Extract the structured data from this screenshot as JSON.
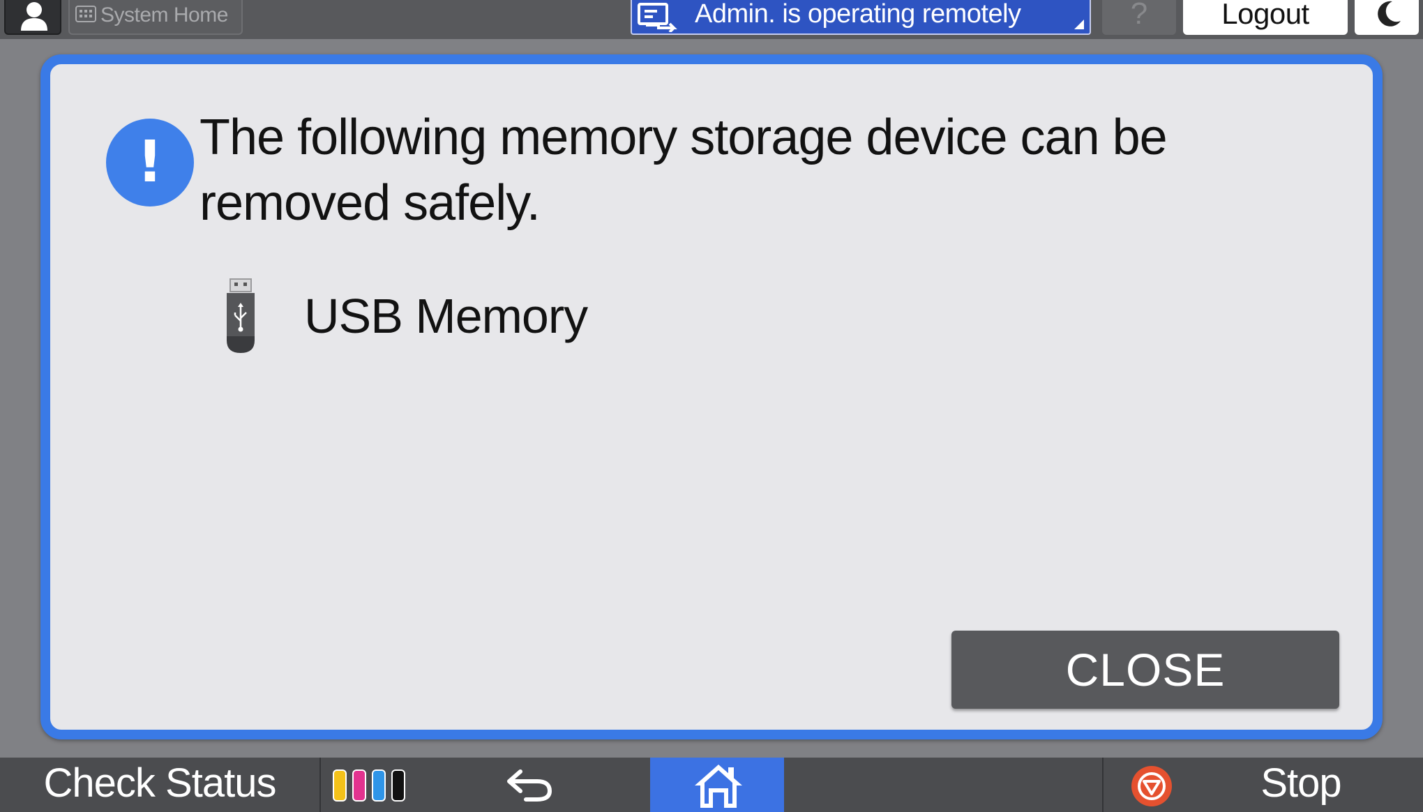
{
  "top_bar": {
    "system_home_label": "System Home",
    "remote_status_text": "Admin. is operating remotely",
    "help_symbol": "?",
    "logout_label": "Logout",
    "icons": {
      "user": "user-icon",
      "system_home": "grid-icon",
      "remote": "remote-operation-icon",
      "sleep": "moon-icon"
    }
  },
  "dialog": {
    "message": "The following memory storage device can be removed safely.",
    "alert_symbol": "!",
    "device_name": "USB Memory",
    "device_icon": "usb-drive-icon",
    "close_label": "CLOSE"
  },
  "bottom_bar": {
    "check_status_label": "Check Status",
    "stop_label": "Stop",
    "icons": {
      "toner": "toner-levels-icon",
      "back": "back-arrow-icon",
      "home": "home-icon",
      "stop": "stop-icon"
    }
  },
  "colors": {
    "accent_blue": "#3a7ae6",
    "remote_banner_blue": "#2e54c2",
    "home_button_blue": "#3c72e3",
    "dialog_background": "#e7e7ea",
    "close_button": "#58595c",
    "stop_red": "#e5512f",
    "toner_yellow": "#f4c21a",
    "toner_magenta": "#e2338f",
    "toner_cyan": "#2f95e8",
    "toner_black": "#111111"
  }
}
